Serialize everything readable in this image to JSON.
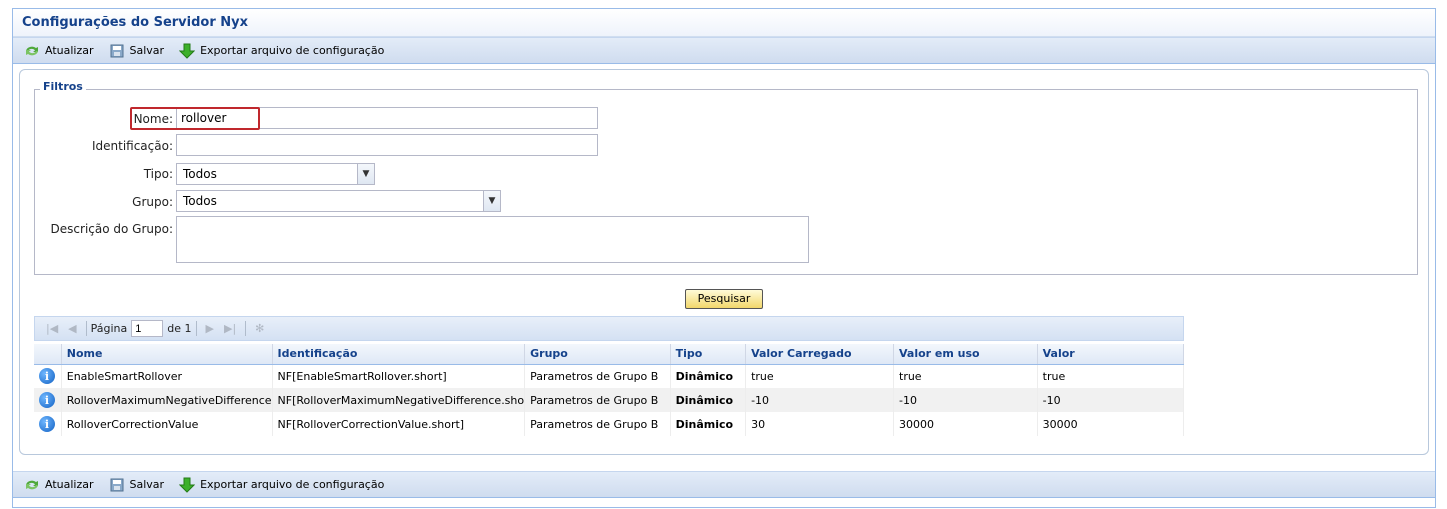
{
  "panel": {
    "title": "Configurações do Servidor Nyx"
  },
  "toolbar": {
    "refresh_label": "Atualizar",
    "save_label": "Salvar",
    "export_label": "Exportar arquivo de configuração"
  },
  "filters": {
    "legend": "Filtros",
    "nome_label": "Nome:",
    "nome_value": "rollover",
    "identificacao_label": "Identificação:",
    "identificacao_value": "",
    "tipo_label": "Tipo:",
    "tipo_value": "Todos",
    "grupo_label": "Grupo:",
    "grupo_value": "Todos",
    "descricao_label": "Descrição do Grupo:",
    "descricao_value": ""
  },
  "search_button": "Pesquisar",
  "pager": {
    "page_label": "Página",
    "page_value": "1",
    "of_label": "de 1"
  },
  "grid": {
    "columns": [
      "Nome",
      "Identificação",
      "Grupo",
      "Tipo",
      "Valor Carregado",
      "Valor em uso",
      "Valor"
    ],
    "rows": [
      [
        "EnableSmartRollover",
        "NF[EnableSmartRollover.short]",
        "Parametros de Grupo B",
        "Dinâmico",
        "true",
        "true",
        "true"
      ],
      [
        "RolloverMaximumNegativeDifference",
        "NF[RolloverMaximumNegativeDifference.sho",
        "Parametros de Grupo B",
        "Dinâmico",
        "-10",
        "-10",
        "-10"
      ],
      [
        "RolloverCorrectionValue",
        "NF[RolloverCorrectionValue.short]",
        "Parametros de Grupo B",
        "Dinâmico",
        "30",
        "30000",
        "30000"
      ]
    ]
  },
  "colors": {
    "accent": "#15428b",
    "border": "#99bbe8",
    "highlight": "#c0282d",
    "tipo_green": "#2a9a1e"
  },
  "icons": {
    "refresh": "refresh-icon",
    "save": "save-icon",
    "export": "export-down-arrow-icon",
    "row": "info-icon"
  }
}
